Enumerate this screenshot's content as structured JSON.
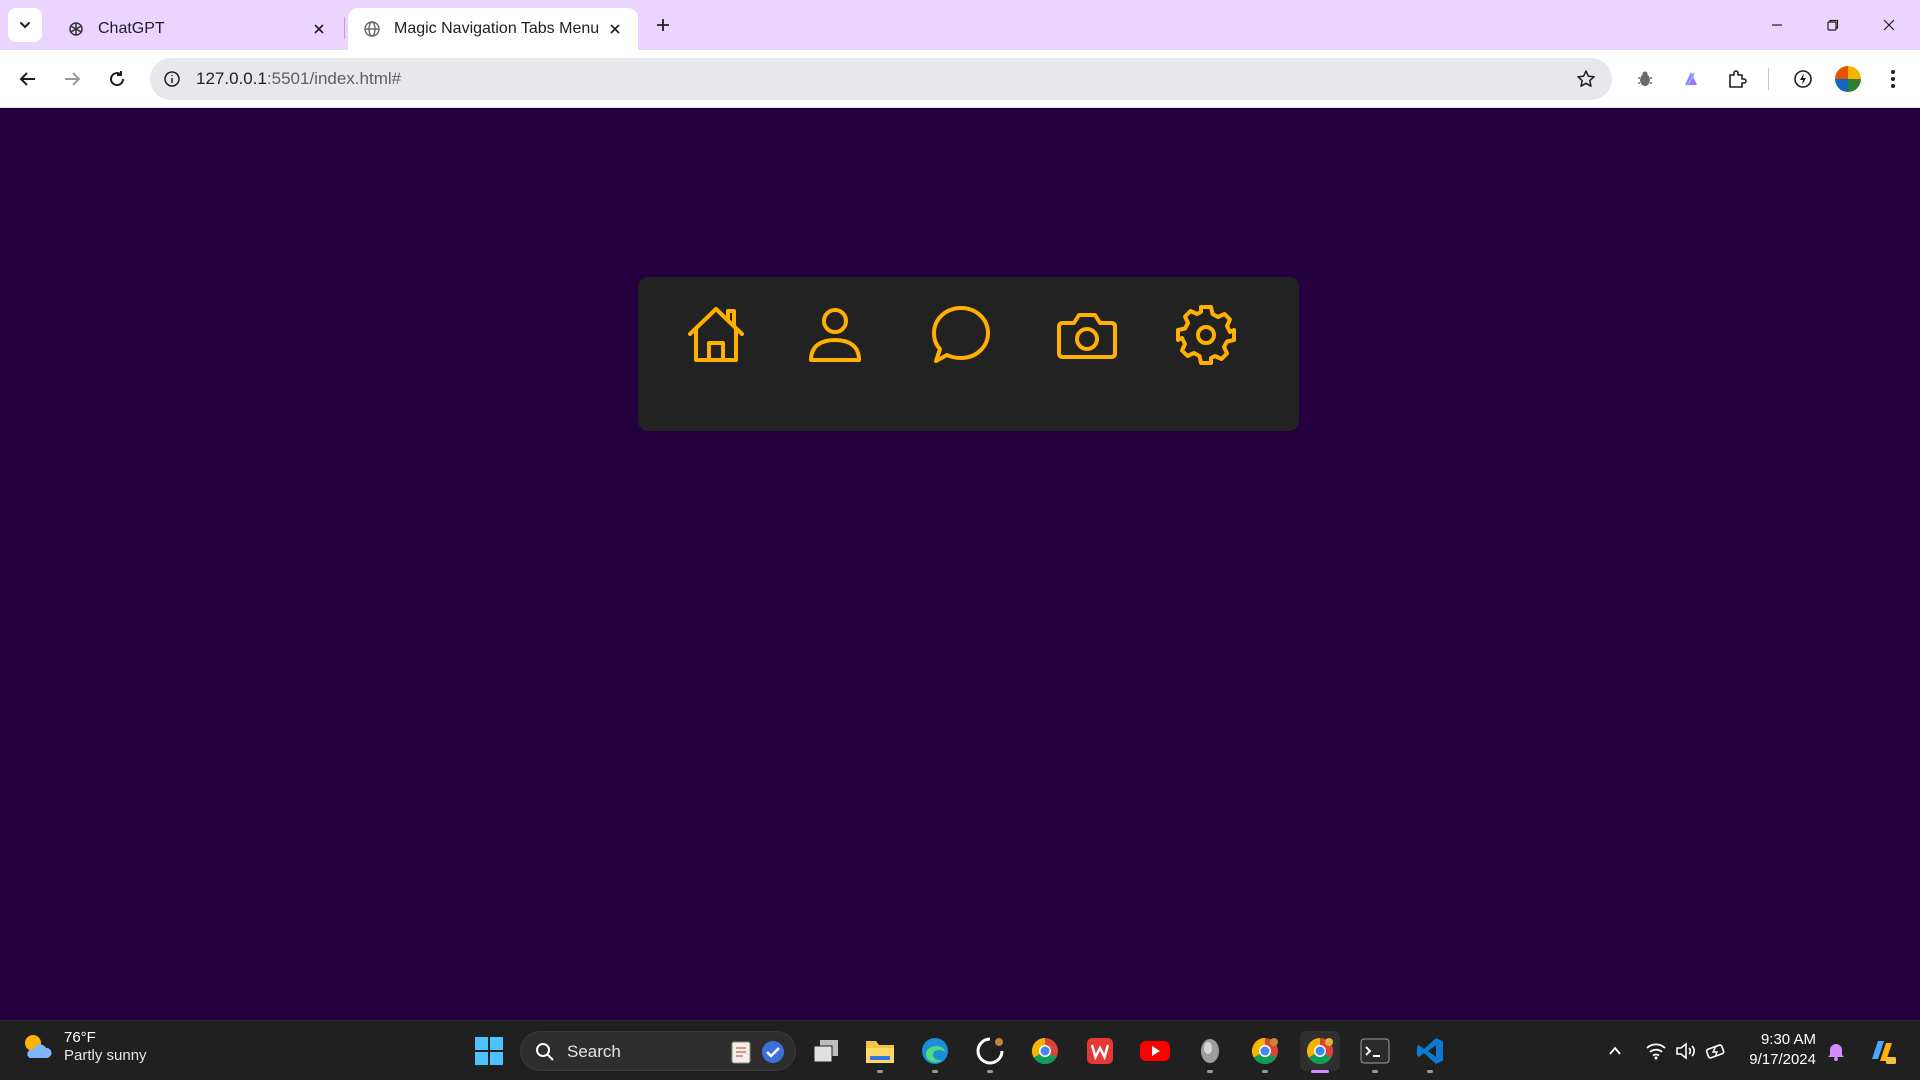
{
  "browser": {
    "tabs": [
      {
        "title": "ChatGPT",
        "active": false,
        "icon": "openai-icon"
      },
      {
        "title": "Magic Navigation Tabs Menu",
        "active": true,
        "icon": "globe-icon"
      }
    ],
    "address": {
      "host": "127.0.0.1",
      "rest": ":5501/index.html#"
    },
    "colors": {
      "tabstrip": "#e9d5ff",
      "toolbar": "#ffffff"
    }
  },
  "page": {
    "background": "#25003f",
    "menu_background": "#222222",
    "icon_color": "#ffb000",
    "nav_items": [
      {
        "name": "home",
        "icon": "home-icon"
      },
      {
        "name": "profile",
        "icon": "user-icon"
      },
      {
        "name": "message",
        "icon": "chat-bubble-icon"
      },
      {
        "name": "photos",
        "icon": "camera-icon"
      },
      {
        "name": "settings",
        "icon": "gear-icon"
      }
    ]
  },
  "taskbar": {
    "weather": {
      "temp": "76°F",
      "condition": "Partly sunny"
    },
    "search_label": "Search",
    "clock": {
      "time": "9:30 AM",
      "date": "9/17/2024"
    },
    "apps": [
      "start-icon",
      "search",
      "task-view-icon",
      "file-explorer-icon",
      "edge-icon",
      "github-icon",
      "chrome-icon",
      "wps-office-icon",
      "youtube-icon",
      "app-icon",
      "chrome-profile-icon",
      "chrome-active-icon",
      "terminal-icon",
      "vscode-icon"
    ]
  }
}
